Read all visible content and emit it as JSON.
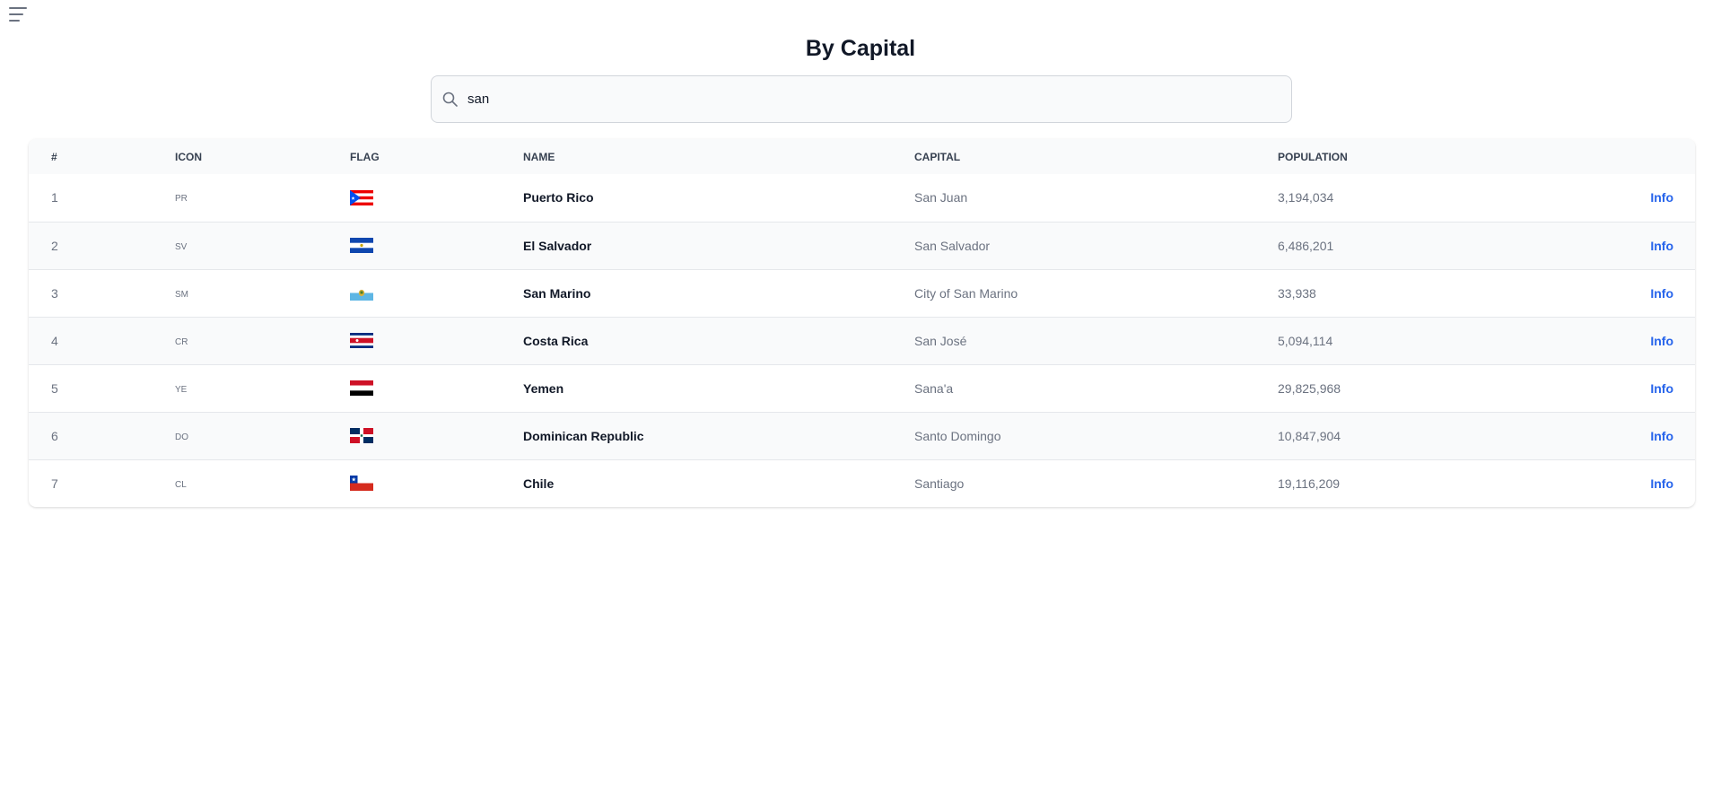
{
  "page": {
    "title": "By Capital"
  },
  "menu": {
    "icon": "hamburger-menu-icon"
  },
  "search": {
    "icon": "search-icon",
    "value": "san",
    "placeholder": ""
  },
  "table": {
    "headers": {
      "index": "#",
      "icon": "ICON",
      "flag": "FLAG",
      "name": "NAME",
      "capital": "CAPITAL",
      "population": "POPULATION"
    },
    "rows": [
      {
        "index": "1",
        "code": "PR",
        "flag": "flag-puerto-rico",
        "name": "Puerto Rico",
        "capital": "San Juan",
        "population": "3,194,034",
        "action": "Info"
      },
      {
        "index": "2",
        "code": "SV",
        "flag": "flag-el-salvador",
        "name": "El Salvador",
        "capital": "San Salvador",
        "population": "6,486,201",
        "action": "Info"
      },
      {
        "index": "3",
        "code": "SM",
        "flag": "flag-san-marino",
        "name": "San Marino",
        "capital": "City of San Marino",
        "population": "33,938",
        "action": "Info"
      },
      {
        "index": "4",
        "code": "CR",
        "flag": "flag-costa-rica",
        "name": "Costa Rica",
        "capital": "San José",
        "population": "5,094,114",
        "action": "Info"
      },
      {
        "index": "5",
        "code": "YE",
        "flag": "flag-yemen",
        "name": "Yemen",
        "capital": "Sana'a",
        "population": "29,825,968",
        "action": "Info"
      },
      {
        "index": "6",
        "code": "DO",
        "flag": "flag-dominican-republic",
        "name": "Dominican Republic",
        "capital": "Santo Domingo",
        "population": "10,847,904",
        "action": "Info"
      },
      {
        "index": "7",
        "code": "CL",
        "flag": "flag-chile",
        "name": "Chile",
        "capital": "Santiago",
        "population": "19,116,209",
        "action": "Info"
      }
    ]
  },
  "colors": {
    "accent": "#2563eb",
    "header_bg": "#f9fafb",
    "border": "#e5e7eb"
  }
}
